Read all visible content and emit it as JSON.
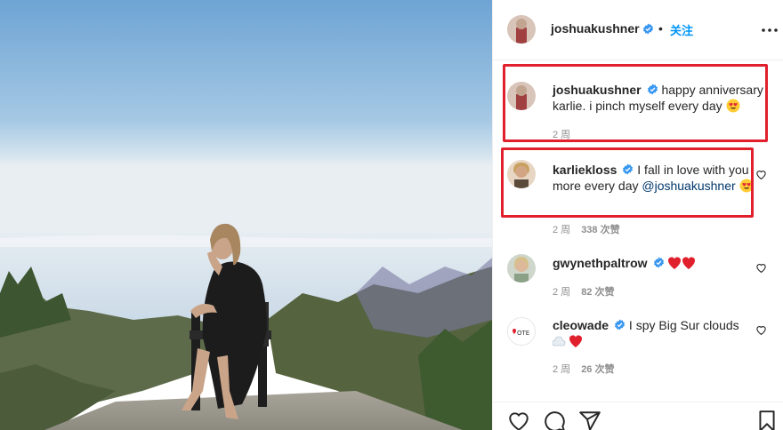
{
  "post": {
    "author": "joshuakushner",
    "follow_label": "关注",
    "separator": "•"
  },
  "comments": [
    {
      "user": "joshuakushner",
      "text": "happy anniversary karlie. i pinch myself every day",
      "emoji": "heart-eyes",
      "age": "2 周",
      "likes": ""
    },
    {
      "user": "karliekloss",
      "text": "I fall in love with you more every day",
      "mention": "@joshuakushner",
      "emoji": "heart-eyes",
      "age": "2 周",
      "likes": "338 次赞"
    },
    {
      "user": "gwynethpaltrow",
      "text": "",
      "emoji": "two-red-hearts",
      "age": "2 周",
      "likes": "82 次赞"
    },
    {
      "user": "cleowade",
      "text": "I spy Big Sur clouds",
      "emoji": "cloud-heart",
      "age": "2 周",
      "likes": "26 次赞"
    }
  ],
  "icons": {
    "more": "more-options-icon",
    "verified": "verified-badge-icon",
    "like": "heart-outline-icon",
    "comment": "comment-bubble-icon",
    "share": "paper-plane-icon",
    "save": "bookmark-icon"
  },
  "colors": {
    "highlight": "#e0202c",
    "link": "#0095f6",
    "verified": "#3897f0",
    "mention": "#00376b"
  }
}
